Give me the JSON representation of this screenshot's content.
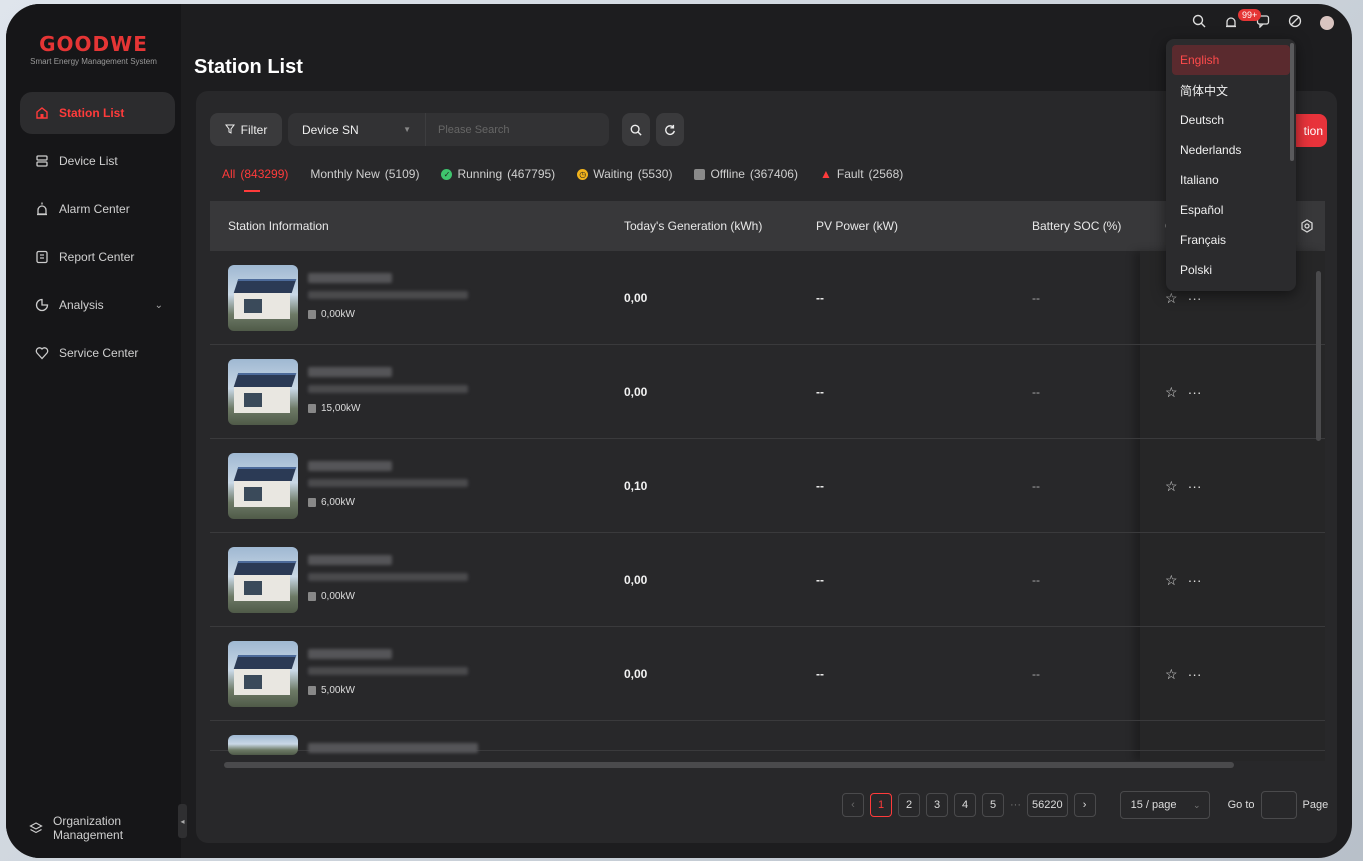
{
  "logo": {
    "text": "GOODWE",
    "subtitle": "Smart Energy Management System"
  },
  "sidebar": {
    "items": [
      {
        "label": "Station List"
      },
      {
        "label": "Device List"
      },
      {
        "label": "Alarm Center"
      },
      {
        "label": "Report Center"
      },
      {
        "label": "Analysis"
      },
      {
        "label": "Service Center"
      }
    ],
    "org_line1": "Organization",
    "org_line2": "Management"
  },
  "header": {
    "title": "Station List",
    "badge": "99+"
  },
  "toolbar": {
    "filter_label": "Filter",
    "select_value": "Device SN",
    "search_placeholder": "Please Search",
    "add_label": "tion"
  },
  "tabs": [
    {
      "label": "All",
      "count": "(843299)"
    },
    {
      "label": "Monthly New",
      "count": "(5109)"
    },
    {
      "label": "Running",
      "count": "(467795)"
    },
    {
      "label": "Waiting",
      "count": "(5530)"
    },
    {
      "label": "Offline",
      "count": "(367406)"
    },
    {
      "label": "Fault",
      "count": "(2568)"
    }
  ],
  "table": {
    "columns": [
      "Station Information",
      "Today's Generation (kWh)",
      "PV Power (kW)",
      "Battery SOC (%)",
      "C"
    ],
    "rows": [
      {
        "capacity": "0,00kW",
        "generation": "0,00",
        "pv_power": "--",
        "soc": "--"
      },
      {
        "capacity": "15,00kW",
        "generation": "0,00",
        "pv_power": "--",
        "soc": "--"
      },
      {
        "capacity": "6,00kW",
        "generation": "0,10",
        "pv_power": "--",
        "soc": "--"
      },
      {
        "capacity": "0,00kW",
        "generation": "0,00",
        "pv_power": "--",
        "soc": "--"
      },
      {
        "capacity": "5,00kW",
        "generation": "0,00",
        "pv_power": "--",
        "soc": "--"
      }
    ],
    "star_icon": "☆",
    "more_icon": "···"
  },
  "pagination": {
    "pages": [
      "1",
      "2",
      "3",
      "4",
      "5"
    ],
    "ellipsis": "···",
    "last": "56220",
    "page_size": "15 / page",
    "goto_label": "Go to",
    "page_label": "Page"
  },
  "language_menu": {
    "items": [
      "English",
      "简体中文",
      "Deutsch",
      "Nederlands",
      "Italiano",
      "Español",
      "Français",
      "Polski"
    ],
    "selected": "English"
  },
  "colors": {
    "accent": "#ff3b3b",
    "bg": "#1d1d1f",
    "panel": "#28282a"
  }
}
